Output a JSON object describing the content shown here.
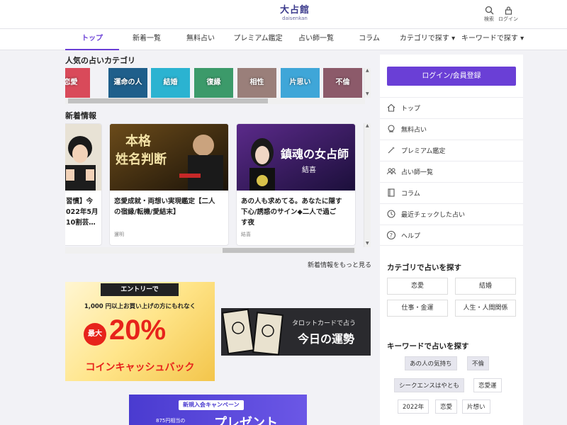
{
  "header": {
    "logo_main": "大占館",
    "logo_sub": "daisenkan",
    "search_label": "検索",
    "login_label": "ログイン"
  },
  "nav": {
    "tabs": [
      {
        "label": "トップ"
      },
      {
        "label": "新着一覧"
      },
      {
        "label": "無料占い"
      },
      {
        "label": "プレミアム鑑定"
      },
      {
        "label": "占い師一覧"
      },
      {
        "label": "コラム"
      },
      {
        "label": "カテゴリで探す ▾"
      },
      {
        "label": "キーワードで探す ▾"
      }
    ]
  },
  "popular": {
    "title": "人気の占いカテゴリ",
    "tiles": [
      {
        "label": "恋愛",
        "color": "#d94a5a"
      },
      {
        "label": "運命の人",
        "color": "#1f5f8b"
      },
      {
        "label": "結婚",
        "color": "#2bb3d1"
      },
      {
        "label": "復縁",
        "color": "#3c9a6a"
      },
      {
        "label": "相性",
        "color": "#9a7f7a"
      },
      {
        "label": "片思い",
        "color": "#3fa6d8"
      },
      {
        "label": "不倫",
        "color": "#8c5a6a"
      }
    ]
  },
  "news": {
    "title": "新着情報",
    "cards": [
      {
        "title_lines": [
          "習慣】今",
          "022年5月",
          "10割芸…"
        ],
        "tag": ""
      },
      {
        "title_lines": [
          "恋愛成就・両想い実現鑑定【二人",
          "の宿縁/転機/愛結末】"
        ],
        "tag": "暹明",
        "image_text": "本格 姓名判断"
      },
      {
        "title_lines": [
          "あの人も求めてる。あなたに隠す",
          "下心/誘惑のサイン◆二人で過ご",
          "す夜"
        ],
        "tag": "結喜",
        "image_text": "鎮魂の女占師"
      }
    ],
    "more_label": "新着情報をもっと見る"
  },
  "banners": {
    "cashback": {
      "entry": "エントリーで",
      "line": "1,000 円以上お買い上げの方にもれなく",
      "max": "最大",
      "percent": "20%",
      "bottom": "コインキャッシュバック"
    },
    "tarot": {
      "sub": "タロットカードで占う",
      "main": "今日の運勢"
    },
    "campaign": {
      "label": "新規入会キャンペーン",
      "small": "875円相当の",
      "big": "プレゼント"
    }
  },
  "sidebar": {
    "login_button": "ログイン/会員登録",
    "menu": [
      {
        "label": "トップ",
        "icon": "home-icon"
      },
      {
        "label": "無料占い",
        "icon": "crystal-icon"
      },
      {
        "label": "プレミアム鑑定",
        "icon": "magic-wand-icon"
      },
      {
        "label": "占い師一覧",
        "icon": "people-icon"
      },
      {
        "label": "コラム",
        "icon": "book-icon"
      },
      {
        "label": "最近チェックした占い",
        "icon": "history-icon"
      },
      {
        "label": "ヘルプ",
        "icon": "help-icon"
      }
    ],
    "category_title": "カテゴリで占いを探す",
    "categories": [
      "恋愛",
      "結婚",
      "仕事・金運",
      "人生・人間関係"
    ],
    "keyword_title": "キーワードで占いを探す",
    "keywords": [
      {
        "label": "あの人の気持ち",
        "highlight": true
      },
      {
        "label": "不倫",
        "highlight": true
      },
      {
        "label": "シークエンスはやとも",
        "highlight": true
      },
      {
        "label": "恋愛運",
        "highlight": false
      },
      {
        "label": "2022年",
        "highlight": false
      },
      {
        "label": "恋愛",
        "highlight": false
      },
      {
        "label": "片想い",
        "highlight": false
      }
    ]
  }
}
